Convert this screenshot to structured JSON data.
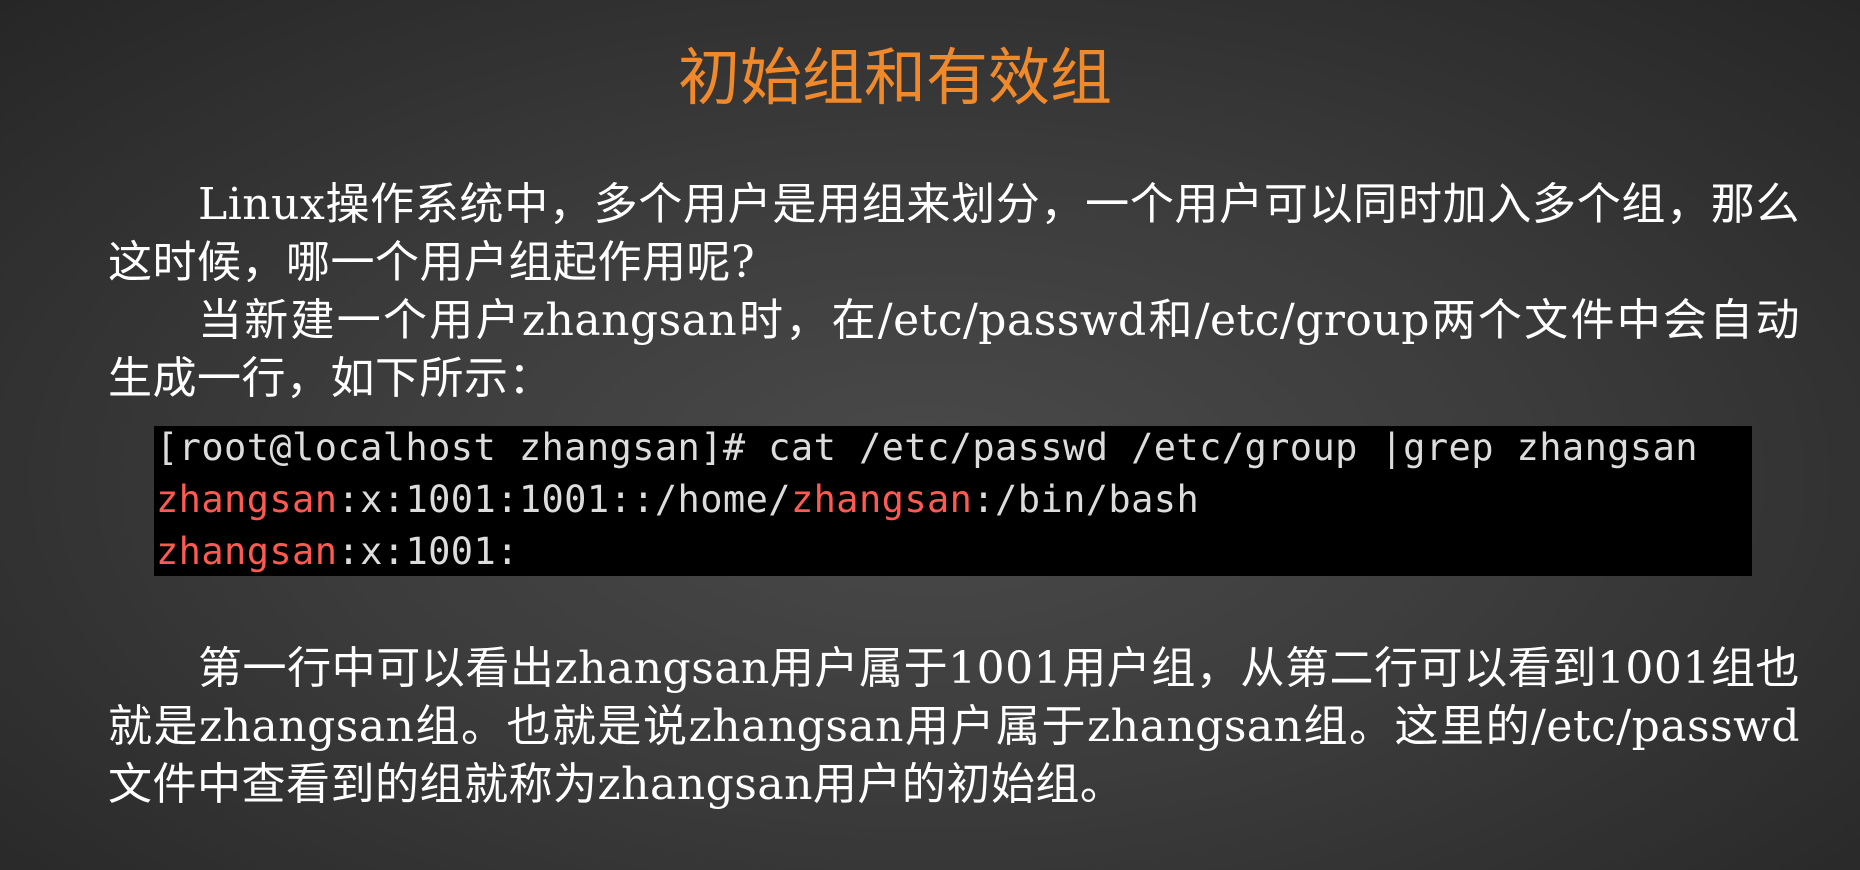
{
  "slide": {
    "title": "初始组和有效组"
  },
  "paragraphs": {
    "p1": "Linux操作系统中，多个用户是用组来划分，一个用户可以同时加入多个组，那么这时候，哪一个用户组起作用呢?",
    "p2": "当新建一个用户zhangsan时，在/etc/passwd和/etc/group两个文件中会自动生成一行，如下所示：",
    "p3": "第一行中可以看出zhangsan用户属于1001用户组，从第二行可以看到1001组也就是zhangsan组。也就是说zhangsan用户属于zhangsan组。这里的/etc/passwd文件中查看到的组就称为zhangsan用户的初始组。"
  },
  "terminal": {
    "command": "[root@localhost zhangsan]# cat /etc/passwd /etc/group |grep zhangsan",
    "line1": {
      "user": "zhangsan",
      "mid": ":x:1001:1001::/home/",
      "home_user": "zhangsan",
      "tail": ":/bin/bash"
    },
    "line2": {
      "user": "zhangsan",
      "tail": ":x:1001:"
    },
    "highlight_color": "#ff5a52"
  },
  "colors": {
    "title": "#f0892a",
    "body_text": "#ffffff",
    "terminal_bg": "#000000",
    "terminal_text": "#dcdcdc"
  }
}
